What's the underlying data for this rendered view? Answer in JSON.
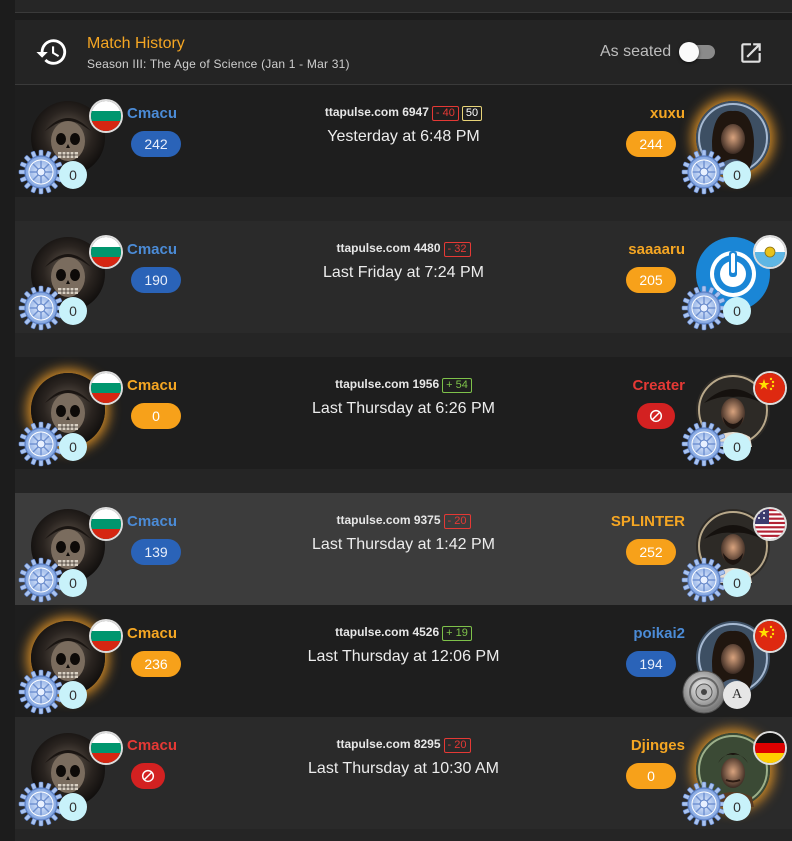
{
  "header": {
    "title": "Match History",
    "subtitle": "Season III: The Age of Science (Jan 1 - Mar 31)",
    "as_seated_label": "As seated"
  },
  "matches": [
    {
      "left_name": "Cmacu",
      "left_score": "242",
      "left_rank": "0",
      "site": "ttapulse.com 6947",
      "delta": "- 40",
      "tag": "50",
      "time": "Yesterday at 6:48 PM",
      "right_name": "xuxu",
      "right_score": "244",
      "right_rank": "0"
    },
    {
      "left_name": "Cmacu",
      "left_score": "190",
      "left_rank": "0",
      "site": "ttapulse.com 4480",
      "delta": "- 32",
      "time": "Last Friday at 7:24 PM",
      "right_name": "saaaaru",
      "right_score": "205",
      "right_rank": "0"
    },
    {
      "left_name": "Cmacu",
      "left_score": "0",
      "left_rank": "0",
      "site": "ttapulse.com 1956",
      "delta": "+ 54",
      "time": "Last Thursday at 6:26 PM",
      "right_name": "Creater",
      "right_rank": "0"
    },
    {
      "left_name": "Cmacu",
      "left_score": "139",
      "left_rank": "0",
      "site": "ttapulse.com 9375",
      "delta": "- 20",
      "time": "Last Thursday at 1:42 PM",
      "right_name": "SPLINTER",
      "right_score": "252",
      "right_rank": "0"
    },
    {
      "left_name": "Cmacu",
      "left_score": "236",
      "left_rank": "0",
      "site": "ttapulse.com 4526",
      "delta": "+ 19",
      "time": "Last Thursday at 12:06 PM",
      "right_name": "poikai2",
      "right_score": "194",
      "right_rank": "A"
    },
    {
      "left_name": "Cmacu",
      "left_rank": "0",
      "site": "ttapulse.com 8295",
      "delta": "- 20",
      "time": "Last Thursday at 10:30 AM",
      "right_name": "Djinges",
      "right_score": "0",
      "right_rank": "0"
    }
  ],
  "colors": {
    "accent": "#f5a623",
    "blue": "#2a63b8",
    "orange": "#f7a11a",
    "red": "#d32121"
  }
}
